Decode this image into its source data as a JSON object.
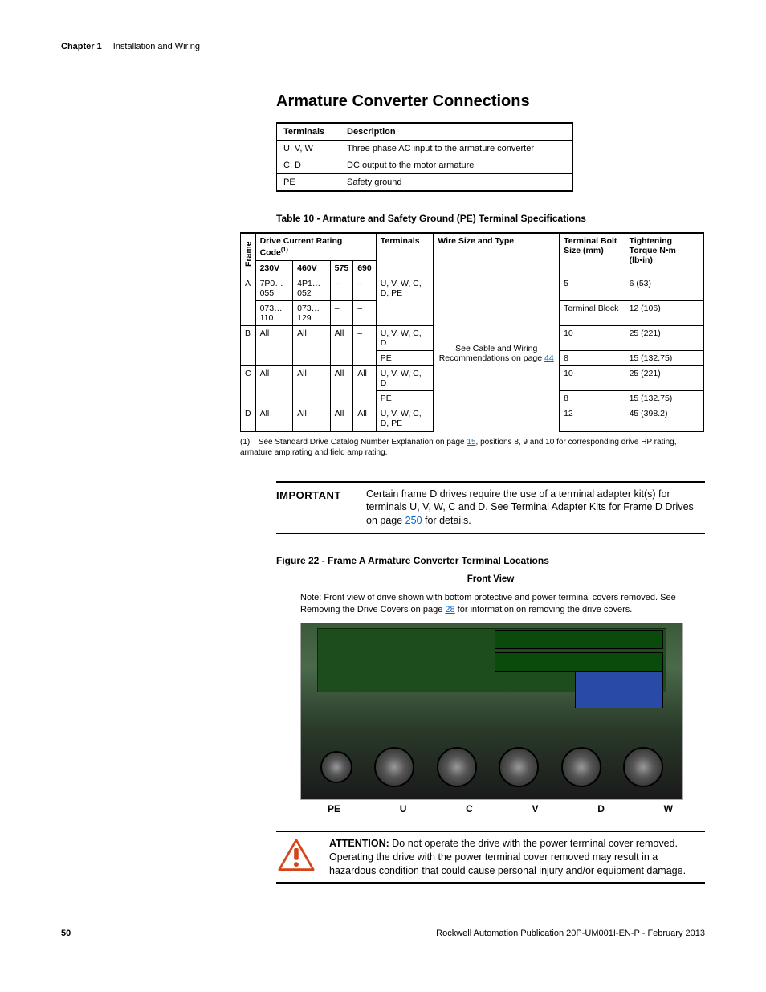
{
  "header": {
    "chapter": "Chapter 1",
    "section": "Installation and Wiring"
  },
  "title": "Armature Converter Connections",
  "table1": {
    "headers": [
      "Terminals",
      "Description"
    ],
    "rows": [
      [
        "U, V, W",
        "Three phase AC input to the armature converter"
      ],
      [
        "C, D",
        "DC output to the motor armature"
      ],
      [
        "PE",
        "Safety ground"
      ]
    ]
  },
  "table2_caption": "Table 10 - Armature and Safety Ground (PE) Terminal Specifications",
  "table2": {
    "corner": "Frame",
    "group_header": "Drive Current Rating Code",
    "group_super": "(1)",
    "col_terminals": "Terminals",
    "col_wire": "Wire Size and Type",
    "col_bolt": "Terminal Bolt Size (mm)",
    "col_torque": "Tightening Torque N•m (lb•in)",
    "sub": [
      "230V",
      "460V",
      "575",
      "690"
    ],
    "wire_text": "See Cable and Wiring Recommendations on page ",
    "wire_link": "44",
    "rows": {
      "A1": {
        "f": "A",
        "c1": "7P0…055",
        "c2": "4P1…052",
        "c3": "–",
        "c4": "–",
        "term": "U, V, W, C, D, PE",
        "bolt": "5",
        "tor": "6 (53)"
      },
      "A2": {
        "c1": "073…110",
        "c2": "073…129",
        "c3": "–",
        "c4": "–",
        "bolt": "Terminal Block",
        "tor": "12 (106)"
      },
      "B1": {
        "f": "B",
        "c1": "All",
        "c2": "All",
        "c3": "All",
        "c4": "–",
        "term": "U, V, W, C, D",
        "bolt": "10",
        "tor": "25 (221)"
      },
      "B2": {
        "term": "PE",
        "bolt": "8",
        "tor": "15 (132.75)"
      },
      "C1": {
        "f": "C",
        "c1": "All",
        "c2": "All",
        "c3": "All",
        "c4": "All",
        "term": "U, V, W, C, D",
        "bolt": "10",
        "tor": "25 (221)"
      },
      "C2": {
        "term": "PE",
        "bolt": "8",
        "tor": "15 (132.75)"
      },
      "D": {
        "f": "D",
        "c1": "All",
        "c2": "All",
        "c3": "All",
        "c4": "All",
        "term": "U, V, W, C, D, PE",
        "bolt": "12",
        "tor": "45 (398.2)"
      }
    }
  },
  "footnote": {
    "num": "(1)",
    "text_a": "See Standard Drive Catalog Number Explanation on page ",
    "link": "15",
    "text_b": ", positions 8, 9 and 10 for corresponding drive HP rating, armature amp rating and field amp rating."
  },
  "important": {
    "label": "IMPORTANT",
    "text_a": "Certain frame D drives require the use of a terminal adapter kit(s) for terminals U, V, W, C and D. See Terminal Adapter Kits for Frame D Drives on page ",
    "link": "250",
    "text_b": " for details."
  },
  "figure": {
    "caption": "Figure 22 - Frame A Armature Converter Terminal Locations",
    "frontview": "Front View",
    "note_a": "Note: Front view of drive shown with bottom protective and power terminal covers removed. See Removing the Drive Covers on page ",
    "note_link": "28",
    "note_b": " for information on removing the drive covers.",
    "labels": [
      "PE",
      "U",
      "C",
      "V",
      "D",
      "W"
    ]
  },
  "attention": {
    "label": "ATTENTION:",
    "text": " Do not operate the drive with the power terminal cover removed. Operating the drive with the power terminal cover removed may result in a hazardous condition that could cause personal injury and/or equipment damage."
  },
  "footer": {
    "page": "50",
    "pub": "Rockwell Automation Publication 20P-UM001I-EN-P - February 2013"
  }
}
